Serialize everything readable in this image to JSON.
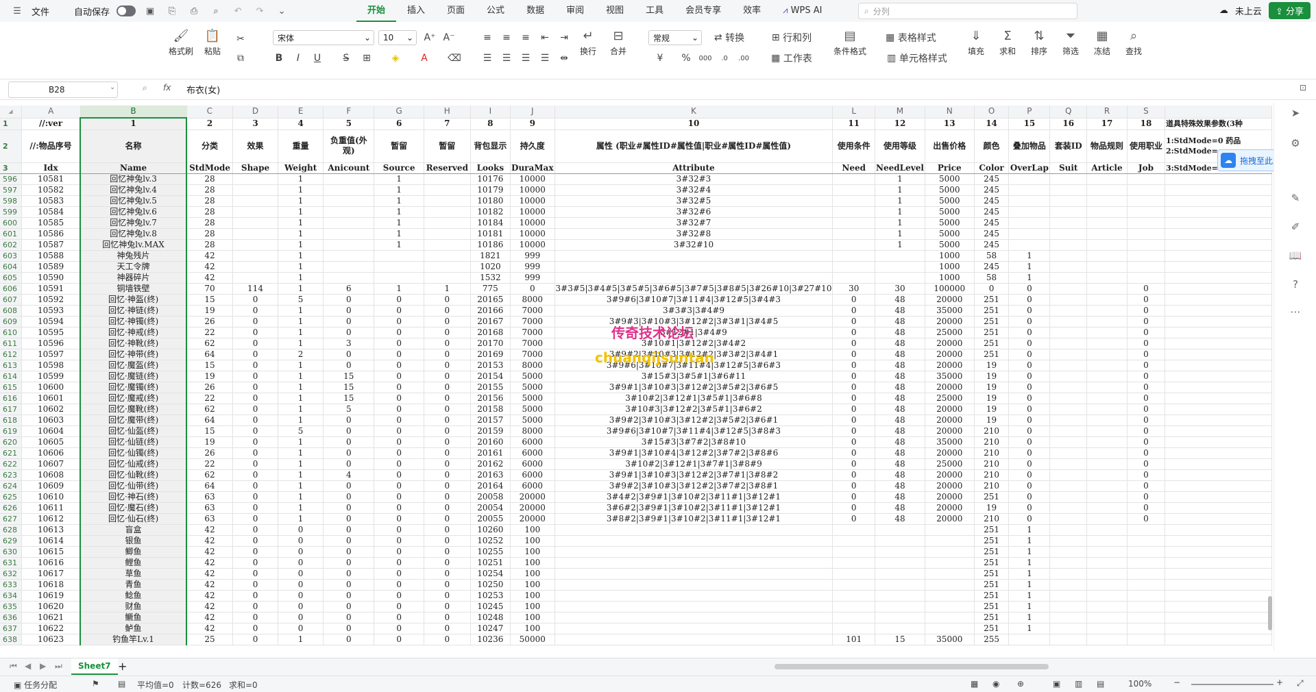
{
  "menubar": {
    "file": "文件",
    "autosave": "自动保存",
    "tabs": [
      "开始",
      "插入",
      "页面",
      "公式",
      "数据",
      "审阅",
      "视图",
      "工具",
      "会员专享",
      "效率"
    ],
    "wps_ai": "WPS AI",
    "search_placeholder": "分列",
    "cloud_status": "未上云",
    "share": "分享"
  },
  "ribbon": {
    "format_painter": "格式刷",
    "paste": "粘贴",
    "font_name": "宋体",
    "font_size": "10",
    "wrap": "换行",
    "merge": "合并",
    "number_format": "常规",
    "convert": "转换",
    "rows_cols": "行和列",
    "worksheet": "工作表",
    "cond_format": "条件格式",
    "table_style": "表格样式",
    "cell_style": "单元格样式",
    "fill": "填充",
    "sum": "求和",
    "sort": "排序",
    "filter": "筛选",
    "freeze": "冻结",
    "find": "查找"
  },
  "formula_bar": {
    "name_box": "B28",
    "formula": "布衣(女)"
  },
  "columns": {
    "letters": [
      "A",
      "B",
      "C",
      "D",
      "E",
      "F",
      "G",
      "H",
      "I",
      "J",
      "K",
      "L",
      "M",
      "N",
      "O",
      "P",
      "Q",
      "R",
      "S"
    ],
    "row1": [
      "//:ver",
      "1",
      "2",
      "3",
      "4",
      "5",
      "6",
      "7",
      "8",
      "9",
      "10",
      "11",
      "12",
      "13",
      "14",
      "15",
      "16",
      "17",
      "18",
      "道具特殊效果参数(3种"
    ],
    "row2": [
      "//:物品序号",
      "名称",
      "分类",
      "效果",
      "重量",
      "负重值(外观)",
      "暂留",
      "暂留",
      "背包显示",
      "持久度",
      "属性 (职业#属性ID#属性值|职业#属性ID#属性值)",
      "使用条件",
      "使用等级",
      "出售价格",
      "颜色",
      "叠加物品",
      "套装ID",
      "物品规则",
      "使用职业",
      "1:StdMode=0 药品"
    ],
    "row3": [
      "Idx",
      "Name",
      "StdMode",
      "Shape",
      "Weight",
      "Anicount",
      "Source",
      "Reserved",
      "Looks",
      "DuraMax",
      "Attribute",
      "Need",
      "NeedLevel",
      "Price",
      "Color",
      "OverLap",
      "Suit",
      "Article",
      "Job",
      "3:StdMode="
    ],
    "extra_t": "2:StdMode="
  },
  "rows": [
    [
      "596",
      "10581",
      "回忆神兔lv.3",
      "28",
      "",
      "1",
      "",
      "1",
      "",
      "10176",
      "10000",
      "3#32#3",
      "",
      "1",
      "5000",
      "245",
      "",
      "",
      "",
      ""
    ],
    [
      "597",
      "10582",
      "回忆神兔lv.4",
      "28",
      "",
      "1",
      "",
      "1",
      "",
      "10179",
      "10000",
      "3#32#4",
      "",
      "1",
      "5000",
      "245",
      "",
      "",
      "",
      ""
    ],
    [
      "598",
      "10583",
      "回忆神兔lv.5",
      "28",
      "",
      "1",
      "",
      "1",
      "",
      "10180",
      "10000",
      "3#32#5",
      "",
      "1",
      "5000",
      "245",
      "",
      "",
      "",
      ""
    ],
    [
      "599",
      "10584",
      "回忆神兔lv.6",
      "28",
      "",
      "1",
      "",
      "1",
      "",
      "10182",
      "10000",
      "3#32#6",
      "",
      "1",
      "5000",
      "245",
      "",
      "",
      "",
      ""
    ],
    [
      "600",
      "10585",
      "回忆神兔lv.7",
      "28",
      "",
      "1",
      "",
      "1",
      "",
      "10184",
      "10000",
      "3#32#7",
      "",
      "1",
      "5000",
      "245",
      "",
      "",
      "",
      ""
    ],
    [
      "601",
      "10586",
      "回忆神兔lv.8",
      "28",
      "",
      "1",
      "",
      "1",
      "",
      "10181",
      "10000",
      "3#32#8",
      "",
      "1",
      "5000",
      "245",
      "",
      "",
      "",
      ""
    ],
    [
      "602",
      "10587",
      "回忆神兔lv.MAX",
      "28",
      "",
      "1",
      "",
      "1",
      "",
      "10186",
      "10000",
      "3#32#10",
      "",
      "1",
      "5000",
      "245",
      "",
      "",
      "",
      ""
    ],
    [
      "603",
      "10588",
      "神兔残片",
      "42",
      "",
      "1",
      "",
      "",
      "",
      "1821",
      "999",
      "",
      "",
      "",
      "1000",
      "58",
      "1",
      "",
      "",
      ""
    ],
    [
      "604",
      "10589",
      "天工令牌",
      "42",
      "",
      "1",
      "",
      "",
      "",
      "1020",
      "999",
      "",
      "",
      "",
      "1000",
      "245",
      "1",
      "",
      "",
      ""
    ],
    [
      "605",
      "10590",
      "神器碎片",
      "42",
      "",
      "1",
      "",
      "",
      "",
      "1532",
      "999",
      "",
      "",
      "",
      "1000",
      "58",
      "1",
      "",
      "",
      ""
    ],
    [
      "606",
      "10591",
      "铜墙铁壁",
      "70",
      "114",
      "1",
      "6",
      "1",
      "1",
      "775",
      "0",
      "3#3#5|3#4#5|3#5#5|3#6#5|3#7#5|3#8#5|3#26#10|3#27#10",
      "30",
      "30",
      "100000",
      "0",
      "0",
      "",
      "",
      "0"
    ],
    [
      "607",
      "10592",
      "回忆·神盔(终)",
      "15",
      "0",
      "5",
      "0",
      "0",
      "0",
      "20165",
      "8000",
      "3#9#6|3#10#7|3#11#4|3#12#5|3#4#3",
      "0",
      "48",
      "20000",
      "251",
      "0",
      "",
      "",
      "0"
    ],
    [
      "608",
      "10593",
      "回忆·神链(终)",
      "19",
      "0",
      "1",
      "0",
      "0",
      "0",
      "20166",
      "7000",
      "3#3#3|3#4#9",
      "0",
      "48",
      "35000",
      "251",
      "0",
      "",
      "",
      "0"
    ],
    [
      "609",
      "10594",
      "回忆·神镯(终)",
      "26",
      "0",
      "1",
      "0",
      "0",
      "0",
      "20167",
      "7000",
      "3#9#3|3#10#3|3#12#2|3#3#1|3#4#5",
      "0",
      "48",
      "20000",
      "251",
      "0",
      "",
      "",
      "0"
    ],
    [
      "610",
      "10595",
      "回忆·神戒(终)",
      "22",
      "0",
      "1",
      "0",
      "0",
      "0",
      "20168",
      "7000",
      "3#12#1|3#4#9",
      "0",
      "48",
      "25000",
      "251",
      "0",
      "",
      "",
      "0"
    ],
    [
      "611",
      "10596",
      "回忆·神靴(终)",
      "62",
      "0",
      "1",
      "3",
      "0",
      "0",
      "20170",
      "7000",
      "3#10#1|3#12#2|3#4#2",
      "0",
      "48",
      "20000",
      "251",
      "0",
      "",
      "",
      "0"
    ],
    [
      "612",
      "10597",
      "回忆·神带(终)",
      "64",
      "0",
      "2",
      "0",
      "0",
      "0",
      "20169",
      "7000",
      "3#9#2|3#10#3|3#12#2|3#3#2|3#4#1",
      "0",
      "48",
      "20000",
      "251",
      "0",
      "",
      "",
      "0"
    ],
    [
      "613",
      "10598",
      "回忆·魔盔(终)",
      "15",
      "0",
      "1",
      "0",
      "0",
      "0",
      "20153",
      "8000",
      "3#9#6|3#10#7|3#11#4|3#12#5|3#6#3",
      "0",
      "48",
      "20000",
      "19",
      "0",
      "",
      "",
      "0"
    ],
    [
      "614",
      "10599",
      "回忆·魔链(终)",
      "19",
      "0",
      "1",
      "15",
      "0",
      "0",
      "20154",
      "5000",
      "3#15#3|3#5#1|3#6#11",
      "0",
      "48",
      "35000",
      "19",
      "0",
      "",
      "",
      "0"
    ],
    [
      "615",
      "10600",
      "回忆·魔镯(终)",
      "26",
      "0",
      "1",
      "15",
      "0",
      "0",
      "20155",
      "5000",
      "3#9#1|3#10#3|3#12#2|3#5#2|3#6#5",
      "0",
      "48",
      "20000",
      "19",
      "0",
      "",
      "",
      "0"
    ],
    [
      "616",
      "10601",
      "回忆·魔戒(终)",
      "22",
      "0",
      "1",
      "15",
      "0",
      "0",
      "20156",
      "5000",
      "3#10#2|3#12#1|3#5#1|3#6#8",
      "0",
      "48",
      "25000",
      "19",
      "0",
      "",
      "",
      "0"
    ],
    [
      "617",
      "10602",
      "回忆·魔靴(终)",
      "62",
      "0",
      "1",
      "5",
      "0",
      "0",
      "20158",
      "5000",
      "3#10#3|3#12#2|3#5#1|3#6#2",
      "0",
      "48",
      "20000",
      "19",
      "0",
      "",
      "",
      "0"
    ],
    [
      "618",
      "10603",
      "回忆·魔带(终)",
      "64",
      "0",
      "1",
      "0",
      "0",
      "0",
      "20157",
      "5000",
      "3#9#2|3#10#3|3#12#2|3#5#2|3#6#1",
      "0",
      "48",
      "20000",
      "19",
      "0",
      "",
      "",
      "0"
    ],
    [
      "619",
      "10604",
      "回忆·仙盔(终)",
      "15",
      "0",
      "5",
      "0",
      "0",
      "0",
      "20159",
      "8000",
      "3#9#6|3#10#7|3#11#4|3#12#5|3#8#3",
      "0",
      "48",
      "20000",
      "210",
      "0",
      "",
      "",
      "0"
    ],
    [
      "620",
      "10605",
      "回忆·仙链(终)",
      "19",
      "0",
      "1",
      "0",
      "0",
      "0",
      "20160",
      "6000",
      "3#15#3|3#7#2|3#8#10",
      "0",
      "48",
      "35000",
      "210",
      "0",
      "",
      "",
      "0"
    ],
    [
      "621",
      "10606",
      "回忆·仙镯(终)",
      "26",
      "0",
      "1",
      "0",
      "0",
      "0",
      "20161",
      "6000",
      "3#9#1|3#10#4|3#12#2|3#7#2|3#8#6",
      "0",
      "48",
      "20000",
      "210",
      "0",
      "",
      "",
      "0"
    ],
    [
      "622",
      "10607",
      "回忆·仙戒(终)",
      "22",
      "0",
      "1",
      "0",
      "0",
      "0",
      "20162",
      "6000",
      "3#10#2|3#12#1|3#7#1|3#8#9",
      "0",
      "48",
      "25000",
      "210",
      "0",
      "",
      "",
      "0"
    ],
    [
      "623",
      "10608",
      "回忆·仙靴(终)",
      "62",
      "0",
      "1",
      "4",
      "0",
      "0",
      "20163",
      "6000",
      "3#9#1|3#10#3|3#12#2|3#7#1|3#8#2",
      "0",
      "48",
      "20000",
      "210",
      "0",
      "",
      "",
      "0"
    ],
    [
      "624",
      "10609",
      "回忆·仙带(终)",
      "64",
      "0",
      "1",
      "0",
      "0",
      "0",
      "20164",
      "6000",
      "3#9#2|3#10#3|3#12#2|3#7#2|3#8#1",
      "0",
      "48",
      "20000",
      "210",
      "0",
      "",
      "",
      "0"
    ],
    [
      "625",
      "10610",
      "回忆·神石(终)",
      "63",
      "0",
      "1",
      "0",
      "0",
      "0",
      "20058",
      "20000",
      "3#4#2|3#9#1|3#10#2|3#11#1|3#12#1",
      "0",
      "48",
      "20000",
      "251",
      "0",
      "",
      "",
      "0"
    ],
    [
      "626",
      "10611",
      "回忆·魔石(终)",
      "63",
      "0",
      "1",
      "0",
      "0",
      "0",
      "20054",
      "20000",
      "3#6#2|3#9#1|3#10#2|3#11#1|3#12#1",
      "0",
      "48",
      "20000",
      "19",
      "0",
      "",
      "",
      "0"
    ],
    [
      "627",
      "10612",
      "回忆·仙石(终)",
      "63",
      "0",
      "1",
      "0",
      "0",
      "0",
      "20055",
      "20000",
      "3#8#2|3#9#1|3#10#2|3#11#1|3#12#1",
      "0",
      "48",
      "20000",
      "210",
      "0",
      "",
      "",
      "0"
    ],
    [
      "628",
      "10613",
      "盲盒",
      "42",
      "0",
      "0",
      "0",
      "0",
      "0",
      "10260",
      "100",
      "",
      "",
      "",
      "",
      "251",
      "1",
      "",
      "",
      ""
    ],
    [
      "629",
      "10614",
      "银鱼",
      "42",
      "0",
      "0",
      "0",
      "0",
      "0",
      "10252",
      "100",
      "",
      "",
      "",
      "",
      "251",
      "1",
      "",
      "",
      ""
    ],
    [
      "630",
      "10615",
      "鲫鱼",
      "42",
      "0",
      "0",
      "0",
      "0",
      "0",
      "10255",
      "100",
      "",
      "",
      "",
      "",
      "251",
      "1",
      "",
      "",
      ""
    ],
    [
      "631",
      "10616",
      "鲤鱼",
      "42",
      "0",
      "0",
      "0",
      "0",
      "0",
      "10251",
      "100",
      "",
      "",
      "",
      "",
      "251",
      "1",
      "",
      "",
      ""
    ],
    [
      "632",
      "10617",
      "草鱼",
      "42",
      "0",
      "0",
      "0",
      "0",
      "0",
      "10254",
      "100",
      "",
      "",
      "",
      "",
      "251",
      "1",
      "",
      "",
      ""
    ],
    [
      "633",
      "10618",
      "青鱼",
      "42",
      "0",
      "0",
      "0",
      "0",
      "0",
      "10250",
      "100",
      "",
      "",
      "",
      "",
      "251",
      "1",
      "",
      "",
      ""
    ],
    [
      "634",
      "10619",
      "鲶鱼",
      "42",
      "0",
      "0",
      "0",
      "0",
      "0",
      "10253",
      "100",
      "",
      "",
      "",
      "",
      "251",
      "1",
      "",
      "",
      ""
    ],
    [
      "635",
      "10620",
      "财鱼",
      "42",
      "0",
      "0",
      "0",
      "0",
      "0",
      "10245",
      "100",
      "",
      "",
      "",
      "",
      "251",
      "1",
      "",
      "",
      ""
    ],
    [
      "636",
      "10621",
      "鳜鱼",
      "42",
      "0",
      "0",
      "0",
      "0",
      "0",
      "10248",
      "100",
      "",
      "",
      "",
      "",
      "251",
      "1",
      "",
      "",
      ""
    ],
    [
      "637",
      "10622",
      "鲈鱼",
      "42",
      "0",
      "0",
      "0",
      "0",
      "0",
      "10247",
      "100",
      "",
      "",
      "",
      "",
      "251",
      "1",
      "",
      "",
      ""
    ],
    [
      "638",
      "10623",
      "钓鱼竿Lv.1",
      "25",
      "0",
      "1",
      "0",
      "0",
      "0",
      "10236",
      "50000",
      "",
      "101",
      "15",
      "35000",
      "255",
      "",
      "",
      "",
      ""
    ]
  ],
  "watermark": {
    "line1": "传奇技术论坛",
    "line2": "chuanqijsuntan"
  },
  "upload": "拖拽至此上传",
  "sheet": {
    "name": "Sheet7"
  },
  "status": {
    "task": "任务分配",
    "avg": "平均值=0",
    "count": "计数=626",
    "sum": "求和=0",
    "zoom": "100%"
  },
  "colors": {
    "accent": "#1a8f3c",
    "watermark1": "#e0328a",
    "watermark2": "#f2c200"
  }
}
